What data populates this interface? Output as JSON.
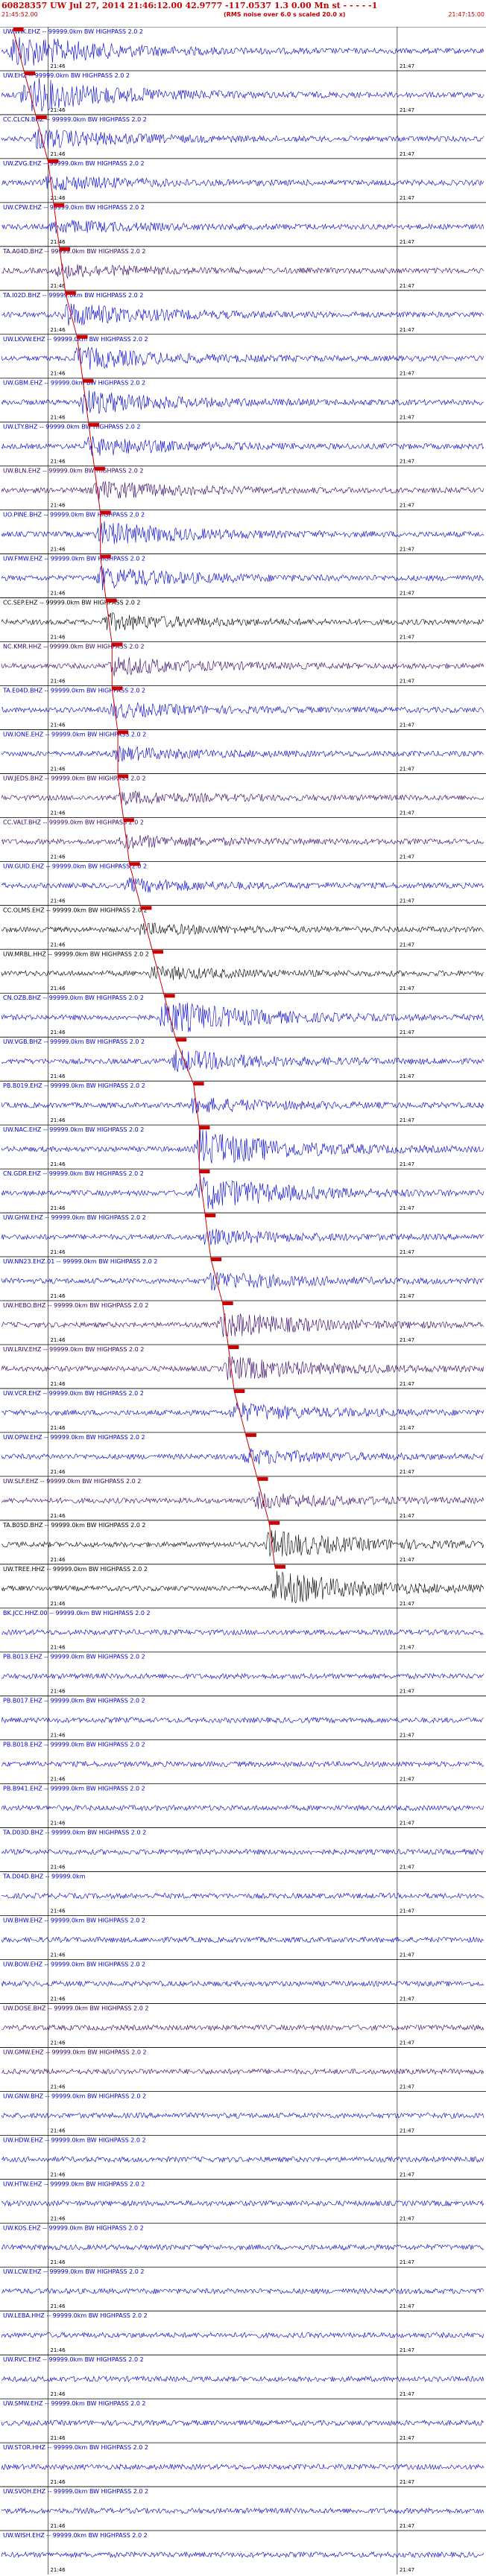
{
  "header": {
    "title": "60828357 UW Jul 27, 2014 21:46:12.00   42.9777  -117.0537   1.3  0.00  Mn  st  - - - - -1",
    "start_time": "21:45:52.00",
    "end_time": "21:47:15.00",
    "note": "(RMS noise over 6.0 s scaled 20.0 x)"
  },
  "chart_data": {
    "type": "line",
    "title": "60828357 UW Jul 27, 2014 21:46:12.00   42.9777  -117.0537   1.3  0.00  Mn  st  - - - - -1",
    "x_start": "21:45:52.00",
    "x_end": "21:47:15.00",
    "tick_labels": [
      "21:46",
      "21:47"
    ],
    "colors": {
      "blue": "#0000cc",
      "purple": "#330066",
      "black": "#000000",
      "pick": "#cc0000",
      "grid": "#000000"
    },
    "traces": [
      {
        "label": "UW.WIK.EHZ -- 99999.0km BW HIGHPASS 2.0 2",
        "color": "blue",
        "pick_s": 2,
        "amplitude": 0.9,
        "onset_s": 1
      },
      {
        "label": "UW.EHZ -- 99999.0km BW HIGHPASS 2.0 2",
        "color": "blue",
        "pick_s": 4,
        "amplitude": 0.95,
        "onset_s": 3
      },
      {
        "label": "CC.CLCN.BHZ -- 99999.0km BW HIGHPASS 2.0 2",
        "color": "blue",
        "pick_s": 6,
        "amplitude": 0.5,
        "onset_s": 5
      },
      {
        "label": "UW.ZVG.EHZ -- 99999.0km BW HIGHPASS 2.0 2",
        "color": "blue",
        "pick_s": 8,
        "amplitude": 0.35,
        "onset_s": 7
      },
      {
        "label": "UW.CPW.EHZ -- 99999.0km BW HIGHPASS 2.0 2",
        "color": "blue",
        "pick_s": 9,
        "amplitude": 0.3,
        "onset_s": 8
      },
      {
        "label": "TA.A04D.BHZ -- 99999.0km BW HIGHPASS 2.0 2",
        "color": "purple",
        "pick_s": 10,
        "amplitude": 0.3,
        "onset_s": 9
      },
      {
        "label": "TA.I02D.BHZ -- 99999.0km BW HIGHPASS 2.0 2",
        "color": "blue",
        "pick_s": 11,
        "amplitude": 0.6,
        "onset_s": 10
      },
      {
        "label": "UW.LKVW.EHZ -- 99999.0km BW HIGHPASS 2.0 2",
        "color": "blue",
        "pick_s": 13,
        "amplitude": 0.55,
        "onset_s": 12
      },
      {
        "label": "UW.GBM.EHZ -- 99999.0km BW HIGHPASS 2.0 2",
        "color": "blue",
        "pick_s": 14,
        "amplitude": 0.6,
        "onset_s": 13
      },
      {
        "label": "UW.LTY.BHZ -- 99999.0km BW HIGHPASS 2.0 2",
        "color": "blue",
        "pick_s": 15,
        "amplitude": 0.45,
        "onset_s": 14
      },
      {
        "label": "UW.BLN.EHZ -- 99999.0km BW HIGHPASS 2.0 2",
        "color": "purple",
        "pick_s": 16,
        "amplitude": 0.45,
        "onset_s": 15
      },
      {
        "label": "UO.PINE.BHZ -- 99999.0km BW HIGHPASS 2.0 2",
        "color": "blue",
        "pick_s": 17,
        "amplitude": 0.6,
        "onset_s": 16
      },
      {
        "label": "UW.FMW.EHZ -- 99999.0km BW HIGHPASS 2.0 2",
        "color": "blue",
        "pick_s": 17,
        "amplitude": 0.55,
        "onset_s": 16
      },
      {
        "label": "CC.SEP.EHZ -- 99999.0km BW HIGHPASS 2.0 2",
        "color": "black",
        "pick_s": 18,
        "amplitude": 0.4,
        "onset_s": 17
      },
      {
        "label": "NC.KMR.HHZ -- 99999.0km BW HIGHPASS 2.0 2",
        "color": "purple",
        "pick_s": 19,
        "amplitude": 0.45,
        "onset_s": 18
      },
      {
        "label": "TA.E04D.BHZ -- 99999.0km BW HIGHPASS 2.0 2",
        "color": "blue",
        "pick_s": 19,
        "amplitude": 0.35,
        "onset_s": 18
      },
      {
        "label": "UW.IONE.EHZ -- 99999.0km BW HIGHPASS 2.0 2",
        "color": "blue",
        "pick_s": 20,
        "amplitude": 0.3,
        "onset_s": 19
      },
      {
        "label": "UW.JEDS.BHZ -- 99999.0km BW HIGHPASS 2.0 2",
        "color": "purple",
        "pick_s": 20,
        "amplitude": 0.3,
        "onset_s": 19
      },
      {
        "label": "CC.VALT.BHZ -- 99999.0km BW HIGHPASS 2.0 2",
        "color": "purple",
        "pick_s": 21,
        "amplitude": 0.3,
        "onset_s": 20
      },
      {
        "label": "UW.GUID.EHZ -- 99999.0km BW HIGHPASS 2.0 2",
        "color": "blue",
        "pick_s": 22,
        "amplitude": 0.3,
        "onset_s": 21
      },
      {
        "label": "CC.OLMS.EHZ -- 99999.0km BW HIGHPASS 2.0 2",
        "color": "black",
        "pick_s": 24,
        "amplitude": 0.25,
        "onset_s": 23
      },
      {
        "label": "UW.MRBL.HHZ -- 99999.0km BW HIGHPASS 2.0 2",
        "color": "black",
        "pick_s": 26,
        "amplitude": 0.3,
        "onset_s": 25
      },
      {
        "label": "CN.OZB.BHZ -- 99999.0km BW HIGHPASS 2.0 2",
        "color": "blue",
        "pick_s": 28,
        "amplitude": 0.9,
        "onset_s": 27
      },
      {
        "label": "UW.VGB.BHZ -- 99999.0km BW HIGHPASS 2.0 2",
        "color": "blue",
        "pick_s": 30,
        "amplitude": 0.55,
        "onset_s": 29
      },
      {
        "label": "PB.B019.EHZ -- 99999.0km BW HIGHPASS 2.0 2",
        "color": "blue",
        "pick_s": 33,
        "amplitude": 0.35,
        "onset_s": 32
      },
      {
        "label": "UW.NAC.EHZ -- 99999.0km BW HIGHPASS 2.0 2",
        "color": "blue",
        "pick_s": 34,
        "amplitude": 1.0,
        "onset_s": 33
      },
      {
        "label": "CN.GDR.EHZ -- 99999.0km BW HIGHPASS 2.0 2",
        "color": "blue",
        "pick_s": 34,
        "amplitude": 0.9,
        "onset_s": 33
      },
      {
        "label": "UW.GHW.EHZ -- 99999.0km BW HIGHPASS 2.0 2",
        "color": "blue",
        "pick_s": 35,
        "amplitude": 0.35,
        "onset_s": 34
      },
      {
        "label": "UW.NN23.EHZ.01 -- 99999.0km BW HIGHPASS 2.0 2",
        "color": "blue",
        "pick_s": 36,
        "amplitude": 0.45,
        "onset_s": 35
      },
      {
        "label": "UW.HEBO.BHZ -- 99999.0km BW HIGHPASS 2.0 2",
        "color": "purple",
        "pick_s": 38,
        "amplitude": 0.65,
        "onset_s": 37
      },
      {
        "label": "UW.LRIV.EHZ -- 99999.0km BW HIGHPASS 2.0 2",
        "color": "purple",
        "pick_s": 39,
        "amplitude": 0.6,
        "onset_s": 38
      },
      {
        "label": "UW.VCR.EHZ -- 99999.0km BW HIGHPASS 2.0 2",
        "color": "blue",
        "pick_s": 40,
        "amplitude": 0.45,
        "onset_s": 39
      },
      {
        "label": "UW.OPW.EHZ -- 99999.0km BW HIGHPASS 2.0 2",
        "color": "blue",
        "pick_s": 42,
        "amplitude": 0.35,
        "onset_s": 41
      },
      {
        "label": "UW.SLF.EHZ -- 99999.0km BW HIGHPASS 2.0 2",
        "color": "purple",
        "pick_s": 44,
        "amplitude": 0.35,
        "onset_s": 43
      },
      {
        "label": "TA.B05D.BHZ -- 99999.0km BW HIGHPASS 2.0 2",
        "color": "black",
        "pick_s": 46,
        "amplitude": 0.7,
        "onset_s": 45
      },
      {
        "label": "UW.TREE.HHZ -- 99999.0km BW HIGHPASS 2.0 2",
        "color": "black",
        "pick_s": 47,
        "amplitude": 0.85,
        "onset_s": 46
      },
      {
        "label": "BK.JCC.HHZ.00 -- 99999.0km BW HIGHPASS 2.0 2",
        "color": "blue",
        "pick_s": null,
        "amplitude": 0.2
      },
      {
        "label": "PB.B013.EHZ -- 99999.0km BW HIGHPASS 2.0 2",
        "color": "blue",
        "pick_s": null,
        "amplitude": 0.2
      },
      {
        "label": "PB.B017.EHZ -- 99999.0km BW HIGHPASS 2.0 2",
        "color": "blue",
        "pick_s": null,
        "amplitude": 0.2
      },
      {
        "label": "PB.B018.EHZ -- 99999.0km BW HIGHPASS 2.0 2",
        "color": "blue",
        "pick_s": null,
        "amplitude": 0.2
      },
      {
        "label": "PB.B941.EHZ -- 99999.0km BW HIGHPASS 2.0 2",
        "color": "blue",
        "pick_s": null,
        "amplitude": 0.2
      },
      {
        "label": "TA.D03D.BHZ -- 99999.0km BW HIGHPASS 2.0 2",
        "color": "blue",
        "pick_s": null,
        "amplitude": 0.2
      },
      {
        "label": "TA.D04D.BHZ -- 99999.0km",
        "color": "blue",
        "pick_s": null,
        "amplitude": 0.2
      },
      {
        "label": "UW.BHW.EHZ -- 99999.0km BW HIGHPASS 2.0 2",
        "color": "blue",
        "pick_s": null,
        "amplitude": 0.2
      },
      {
        "label": "UW.BOW.EHZ -- 99999.0km BW HIGHPASS 2.0 2",
        "color": "blue",
        "pick_s": null,
        "amplitude": 0.2
      },
      {
        "label": "UW.DOSE.BHZ -- 99999.0km BW HIGHPASS 2.0 2",
        "color": "purple",
        "pick_s": null,
        "amplitude": 0.2
      },
      {
        "label": "UW.GMW.EHZ -- 99999.0km BW HIGHPASS 2.0 2",
        "color": "purple",
        "pick_s": null,
        "amplitude": 0.2
      },
      {
        "label": "UW.GNW.BHZ -- 99999.0km BW HIGHPASS 2.0 2",
        "color": "blue",
        "pick_s": null,
        "amplitude": 0.2
      },
      {
        "label": "UW.HDW.EHZ -- 99999.0km BW HIGHPASS 2.0 2",
        "color": "blue",
        "pick_s": null,
        "amplitude": 0.2
      },
      {
        "label": "UW.HTW.EHZ -- 99999.0km BW HIGHPASS 2.0 2",
        "color": "blue",
        "pick_s": null,
        "amplitude": 0.2
      },
      {
        "label": "UW.KOS.EHZ -- 99999.0km BW HIGHPASS 2.0 2",
        "color": "blue",
        "pick_s": null,
        "amplitude": 0.2
      },
      {
        "label": "UW.LCW.EHZ -- 99999.0km BW HIGHPASS 2.0 2",
        "color": "blue",
        "pick_s": null,
        "amplitude": 0.2
      },
      {
        "label": "UW.LEBA.HHZ -- 99999.0km BW HIGHPASS 2.0 2",
        "color": "blue",
        "pick_s": null,
        "amplitude": 0.2
      },
      {
        "label": "UW.RVC.EHZ -- 99999.0km BW HIGHPASS 2.0 2",
        "color": "blue",
        "pick_s": null,
        "amplitude": 0.2
      },
      {
        "label": "UW.SMW.EHZ -- 99999.0km BW HIGHPASS 2.0 2",
        "color": "blue",
        "pick_s": null,
        "amplitude": 0.2
      },
      {
        "label": "UW.STOR.HHZ -- 99999.0km BW HIGHPASS 2.0 2",
        "color": "blue",
        "pick_s": null,
        "amplitude": 0.2
      },
      {
        "label": "UW.SVOH.EHZ -- 99999.0km BW HIGHPASS 2.0 2",
        "color": "blue",
        "pick_s": null,
        "amplitude": 0.2
      },
      {
        "label": "UW.WISH.EHZ -- 99999.0km BW HIGHPASS 2.0 2",
        "color": "blue",
        "pick_s": null,
        "amplitude": 0.2
      }
    ]
  }
}
